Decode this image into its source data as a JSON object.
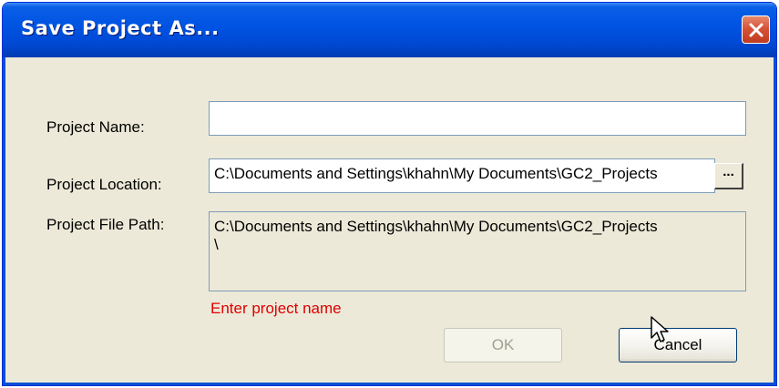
{
  "window": {
    "title": "Save Project As...",
    "close_icon": "close-icon"
  },
  "form": {
    "project_name_label": "Project Name:",
    "project_name_value": "",
    "project_location_label": "Project Location:",
    "project_location_value": "C:\\Documents and Settings\\khahn\\My Documents\\GC2_Projects",
    "browse_label": "...",
    "project_file_path_label": "Project File Path:",
    "project_file_path_value": "C:\\Documents and Settings\\khahn\\My Documents\\GC2_Projects\n\\",
    "error_message": "Enter project name"
  },
  "buttons": {
    "ok_label": "OK",
    "cancel_label": "Cancel"
  },
  "colors": {
    "title_bar": "#0054e3",
    "error_text": "#e00000",
    "dialog_bg": "#ece9d8"
  }
}
